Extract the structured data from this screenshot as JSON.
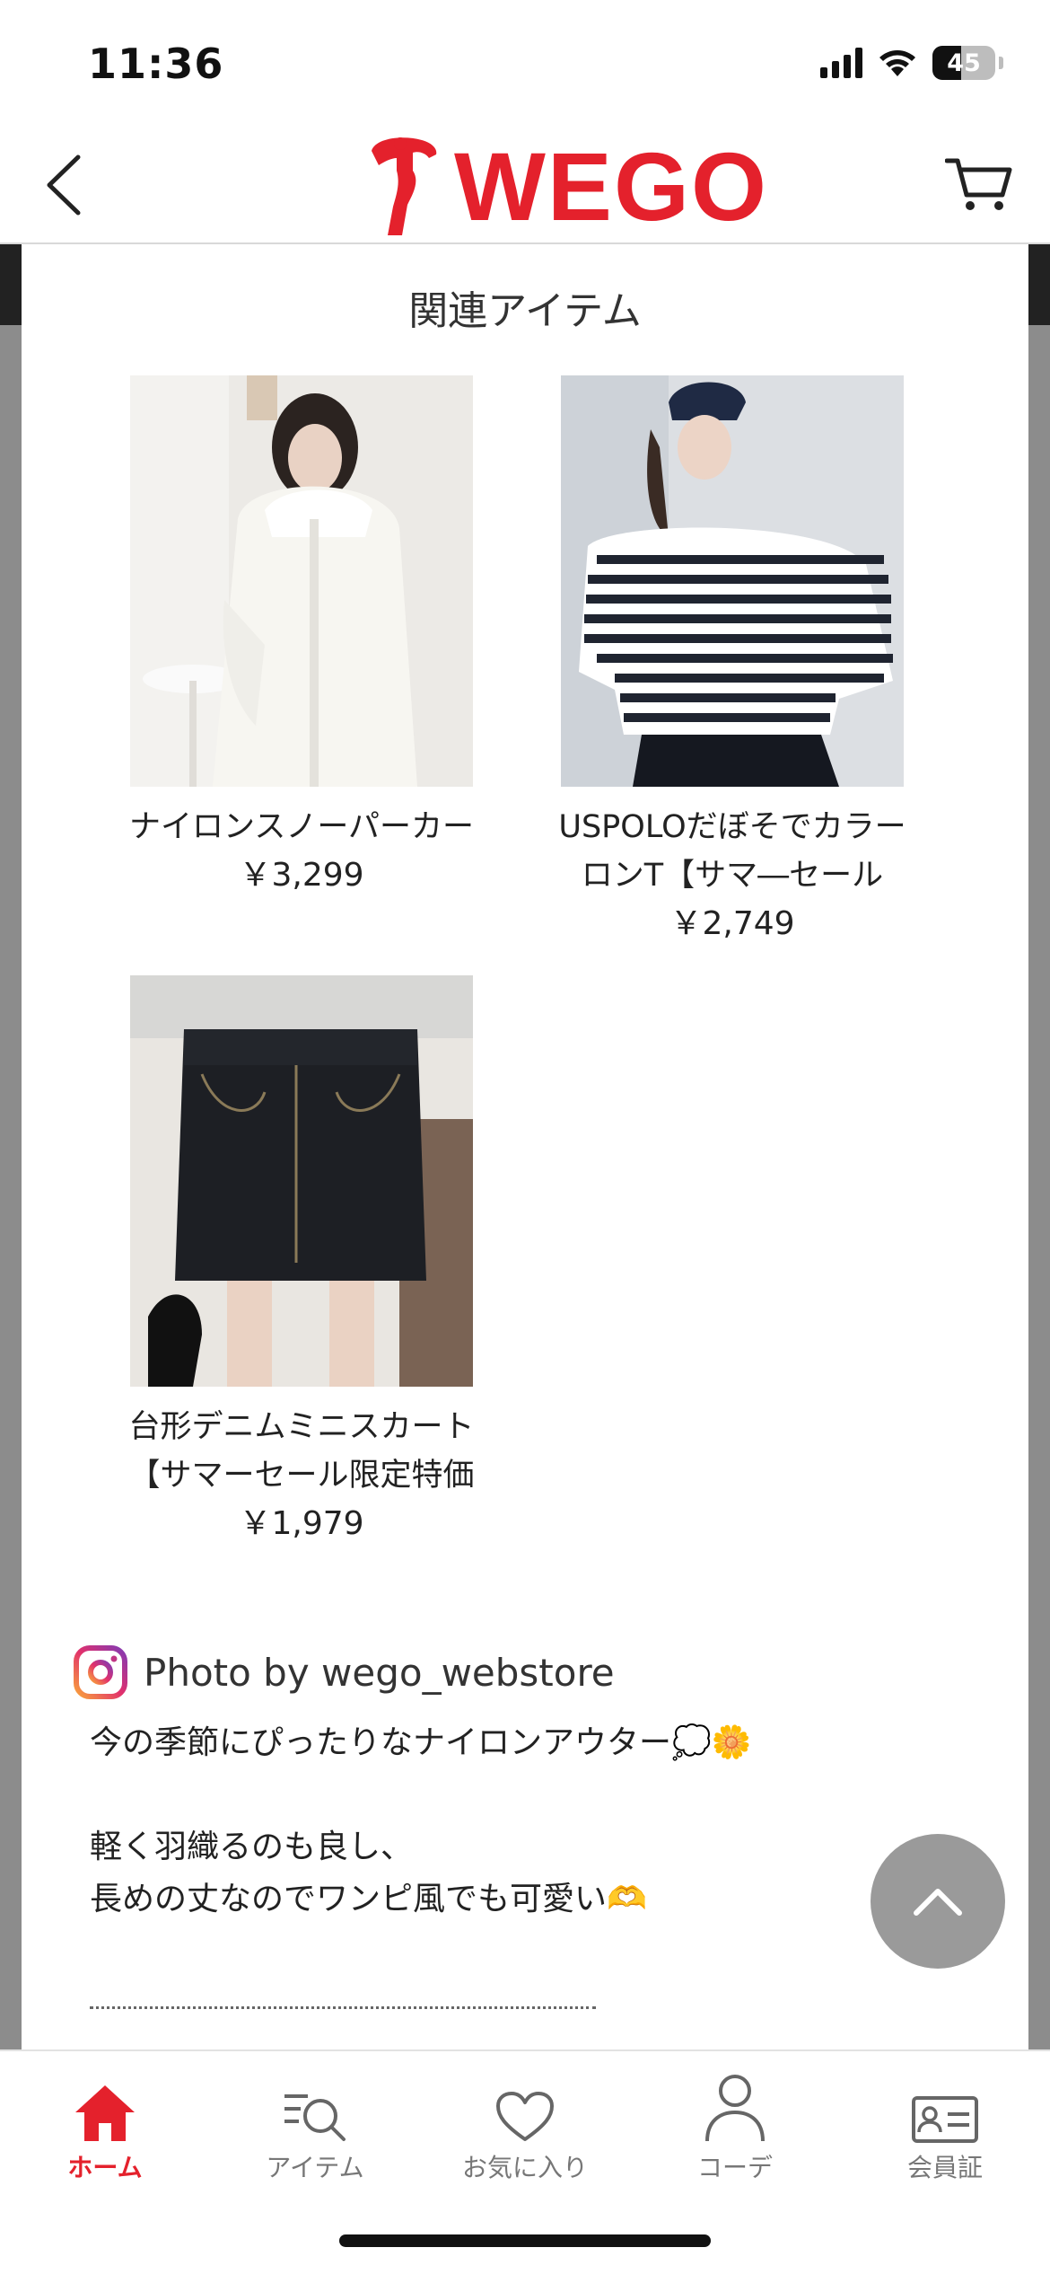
{
  "status_bar": {
    "time": "11:36",
    "battery": "45",
    "battery_level": 0.45
  },
  "header": {
    "logo_text": "WEGO"
  },
  "modal": {
    "title": "関連アイテム",
    "items": [
      {
        "name": "ナイロンスノーパーカー",
        "price": "￥3,299"
      },
      {
        "name": "USPOLOだぼそでカラーロンT【サマ―セール WEB限",
        "price": "￥2,749"
      },
      {
        "name": "台形デニムミニスカート【サマーセール限定特価",
        "price": "￥1,979"
      }
    ],
    "instagram": {
      "credit": "Photo by wego_webstore"
    },
    "caption": {
      "line1": "今の季節にぴったりなナイロンアウター💭🌼",
      "line2": "",
      "line3": "軽く羽織るのも良し、",
      "line4": "長めの丈なのでワンピ風でも可愛い🫶"
    }
  },
  "tab_bar": {
    "tabs": [
      {
        "label": "ホーム",
        "icon": "home-icon",
        "active": true
      },
      {
        "label": "アイテム",
        "icon": "item-search-icon"
      },
      {
        "label": "お気に入り",
        "icon": "heart-icon"
      },
      {
        "label": "コーデ",
        "icon": "person-icon"
      },
      {
        "label": "会員証",
        "icon": "member-card-icon"
      }
    ]
  },
  "colors": {
    "brand": "#e4212c",
    "scroll_button": "#9a9a9a",
    "backdrop": "#8c8c8c"
  }
}
